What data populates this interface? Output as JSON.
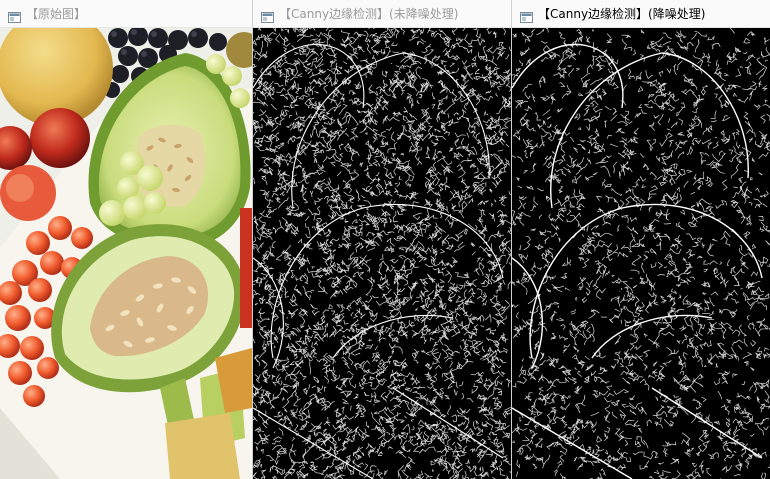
{
  "windows": [
    {
      "title": "【原始图】",
      "state": "inactive",
      "icon": "window-app-icon"
    },
    {
      "title": "【Canny边缘检测】(未降噪处理)",
      "state": "inactive",
      "icon": "window-app-icon"
    },
    {
      "title": "【Canny边缘检测】(降噪处理)",
      "state": "active",
      "icon": "window-app-icon"
    }
  ],
  "colors": {
    "titlebar_bg": "#fafafa",
    "inactive_title": "#9a9a9a",
    "active_title": "#000000",
    "edge_bg": "#000000",
    "edge_line": "#ffffff"
  }
}
